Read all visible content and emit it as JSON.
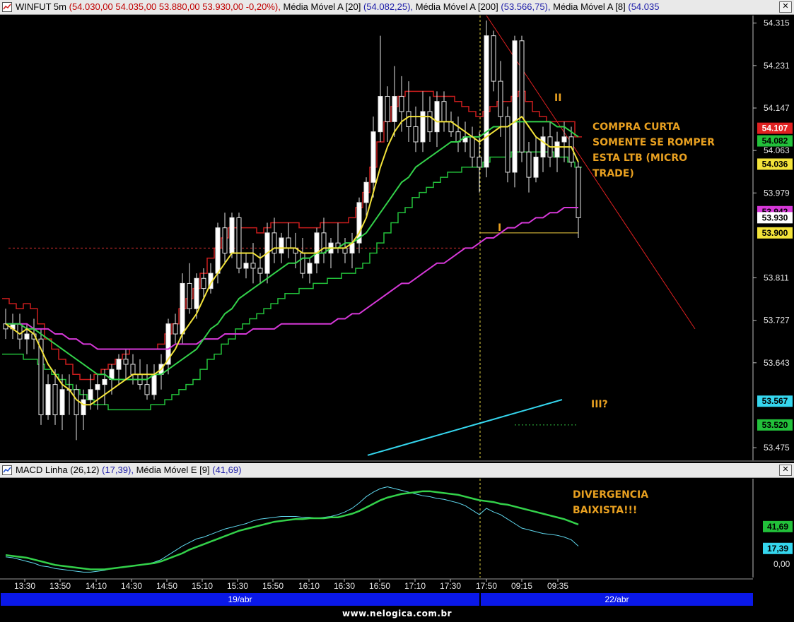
{
  "price_window": {
    "title_symbol": "WINFUT 5m",
    "title_ohlc": "(54.030,00  54.035,00  53.880,00  53.930,00  -0,20%),",
    "title_ma20_label": "Média Móvel A [20]",
    "title_ma20_value": "(54.082,25),",
    "title_ma200_label": "Média Móvel A [200]",
    "title_ma200_value": "(53.566,75),",
    "title_ma8_label": "Média Móvel A [8]",
    "title_ma8_value": "(54.035",
    "close_glyph": "✕"
  },
  "macd_window": {
    "title_label": "MACD Linha (26,12)",
    "title_value": "(17,39),",
    "title_signal_label": "Média Móvel E [9]",
    "title_signal_value": "(41,69)",
    "close_glyph": "✕"
  },
  "annotations": {
    "compra": [
      "COMPRA CURTA",
      "SOMENTE SE ROMPER",
      "ESTA LTB (MICRO",
      "TRADE)"
    ],
    "wave1": "I",
    "wave2": "II",
    "wave3": "III?",
    "divergencia": [
      "DIVERGENCIA",
      "BAIXISTA!!!"
    ]
  },
  "date_bands": {
    "left": "19/abr",
    "right": "22/abr"
  },
  "credit": "www.nelogica.com.br",
  "colors": {
    "ma8": "#f3e33a",
    "ma20": "#33d14a",
    "ma200_pink": "#d638d8",
    "ma_cyan": "#35d6ee",
    "stop_red": "#e02020",
    "stop_green": "#22c03a",
    "note": "#e8a020",
    "macd": "#5fd8ee",
    "signal": "#33d14a",
    "band": "#0a18e8"
  },
  "chart_data": [
    {
      "type": "candlestick",
      "title": "WINFUT 5m",
      "ylim": [
        53.45,
        54.33
      ],
      "y_ticks": [
        "54.315",
        "54.231",
        "54.147",
        "54.063",
        "53.979",
        "53.811",
        "53.727",
        "53.643",
        "53.475"
      ],
      "x_ticks": [
        "13:30",
        "13:50",
        "14:10",
        "14:30",
        "14:50",
        "15:10",
        "15:30",
        "15:50",
        "16:10",
        "16:30",
        "16:50",
        "17:10",
        "17:30",
        "17:50",
        "09:15",
        "09:35"
      ],
      "candles": [
        [
          53.72,
          53.75,
          53.69,
          53.71
        ],
        [
          53.71,
          53.74,
          53.69,
          53.72
        ],
        [
          53.72,
          53.74,
          53.67,
          53.69
        ],
        [
          53.69,
          53.72,
          53.66,
          53.7
        ],
        [
          53.7,
          53.73,
          53.67,
          53.69
        ],
        [
          53.69,
          53.71,
          53.52,
          53.54
        ],
        [
          53.54,
          53.62,
          53.53,
          53.6
        ],
        [
          53.6,
          53.63,
          53.52,
          53.54
        ],
        [
          53.54,
          53.62,
          53.51,
          53.59
        ],
        [
          53.59,
          53.62,
          53.54,
          53.59
        ],
        [
          53.59,
          53.6,
          53.49,
          53.54
        ],
        [
          53.54,
          53.59,
          53.51,
          53.57
        ],
        [
          53.57,
          53.62,
          53.55,
          53.59
        ],
        [
          53.59,
          53.62,
          53.55,
          53.6
        ],
        [
          53.6,
          53.63,
          53.56,
          53.61
        ],
        [
          53.61,
          53.64,
          53.58,
          53.63
        ],
        [
          53.63,
          53.66,
          53.6,
          53.65
        ],
        [
          53.65,
          53.67,
          53.61,
          53.64
        ],
        [
          53.64,
          53.66,
          53.6,
          53.62
        ],
        [
          53.62,
          53.65,
          53.59,
          53.6
        ],
        [
          53.6,
          53.64,
          53.57,
          53.58
        ],
        [
          53.58,
          53.64,
          53.57,
          53.62
        ],
        [
          53.62,
          53.66,
          53.59,
          53.64
        ],
        [
          53.64,
          53.73,
          53.62,
          53.72
        ],
        [
          53.72,
          53.74,
          53.68,
          53.7
        ],
        [
          53.7,
          53.82,
          53.68,
          53.8
        ],
        [
          53.8,
          53.84,
          53.74,
          53.75
        ],
        [
          53.75,
          53.82,
          53.73,
          53.81
        ],
        [
          53.81,
          53.83,
          53.77,
          53.79
        ],
        [
          53.79,
          53.84,
          53.78,
          53.82
        ],
        [
          53.82,
          53.92,
          53.8,
          53.91
        ],
        [
          53.91,
          53.94,
          53.84,
          53.86
        ],
        [
          53.86,
          53.94,
          53.85,
          53.93
        ],
        [
          53.93,
          53.94,
          53.82,
          53.83
        ],
        [
          53.83,
          53.86,
          53.81,
          53.84
        ],
        [
          53.84,
          53.88,
          53.8,
          53.83
        ],
        [
          53.83,
          53.86,
          53.8,
          53.82
        ],
        [
          53.82,
          53.92,
          53.8,
          53.9
        ],
        [
          53.9,
          53.93,
          53.84,
          53.86
        ],
        [
          53.86,
          53.9,
          53.84,
          53.89
        ],
        [
          53.89,
          53.92,
          53.85,
          53.87
        ],
        [
          53.87,
          53.9,
          53.83,
          53.86
        ],
        [
          53.86,
          53.89,
          53.81,
          53.82
        ],
        [
          53.82,
          53.85,
          53.8,
          53.84
        ],
        [
          53.84,
          53.91,
          53.82,
          53.9
        ],
        [
          53.9,
          53.93,
          53.84,
          53.86
        ],
        [
          53.86,
          53.89,
          53.83,
          53.88
        ],
        [
          53.88,
          53.92,
          53.86,
          53.87
        ],
        [
          53.87,
          53.89,
          53.84,
          53.86
        ],
        [
          53.86,
          53.9,
          53.83,
          53.88
        ],
        [
          53.88,
          53.97,
          53.86,
          53.96
        ],
        [
          53.96,
          54.01,
          53.93,
          54.0
        ],
        [
          54.0,
          54.13,
          53.97,
          54.1
        ],
        [
          54.1,
          54.29,
          54.08,
          54.17
        ],
        [
          54.17,
          54.19,
          54.08,
          54.12
        ],
        [
          54.12,
          54.23,
          54.09,
          54.17
        ],
        [
          54.17,
          54.21,
          54.1,
          54.14
        ],
        [
          54.14,
          54.2,
          54.08,
          54.11
        ],
        [
          54.11,
          54.15,
          54.06,
          54.08
        ],
        [
          54.08,
          54.18,
          54.06,
          54.14
        ],
        [
          54.14,
          54.17,
          54.08,
          54.1
        ],
        [
          54.1,
          54.18,
          54.07,
          54.16
        ],
        [
          54.16,
          54.18,
          54.1,
          54.12
        ],
        [
          54.12,
          54.14,
          54.09,
          54.1
        ],
        [
          54.1,
          54.13,
          54.06,
          54.08
        ],
        [
          54.08,
          54.12,
          54.06,
          54.09
        ],
        [
          54.09,
          54.11,
          54.03,
          54.05
        ],
        [
          54.05,
          54.1,
          53.98,
          54.03
        ],
        [
          54.03,
          54.32,
          54.01,
          54.29
        ],
        [
          54.29,
          54.3,
          54.18,
          54.2
        ],
        [
          54.2,
          54.24,
          54.09,
          54.13
        ],
        [
          54.13,
          54.15,
          54.0,
          54.02
        ],
        [
          54.02,
          54.29,
          53.99,
          54.28
        ],
        [
          54.28,
          54.29,
          54.04,
          54.06
        ],
        [
          54.06,
          54.08,
          53.98,
          54.01
        ],
        [
          54.01,
          54.09,
          54.0,
          54.05
        ],
        [
          54.05,
          54.11,
          54.02,
          54.09
        ],
        [
          54.09,
          54.12,
          54.03,
          54.05
        ],
        [
          54.05,
          54.1,
          54.02,
          54.08
        ],
        [
          54.08,
          54.12,
          54.04,
          54.09
        ],
        [
          54.09,
          54.11,
          54.03,
          54.04
        ],
        [
          54.03,
          54.04,
          53.89,
          53.93
        ]
      ],
      "overlays": {
        "ma8": [
          53.72,
          53.71,
          53.7,
          53.71,
          53.7,
          53.67,
          53.64,
          53.62,
          53.6,
          53.59,
          53.57,
          53.56,
          53.56,
          53.57,
          53.58,
          53.59,
          53.6,
          53.61,
          53.62,
          53.62,
          53.62,
          53.62,
          53.63,
          53.65,
          53.67,
          53.7,
          53.72,
          53.74,
          53.77,
          53.8,
          53.82,
          53.84,
          53.86,
          53.86,
          53.86,
          53.86,
          53.85,
          53.86,
          53.87,
          53.87,
          53.87,
          53.87,
          53.86,
          53.86,
          53.86,
          53.87,
          53.87,
          53.87,
          53.87,
          53.88,
          53.9,
          53.93,
          53.98,
          54.03,
          54.07,
          54.1,
          54.12,
          54.13,
          54.13,
          54.13,
          54.13,
          54.12,
          54.12,
          54.12,
          54.11,
          54.1,
          54.09,
          54.08,
          54.09,
          54.1,
          54.11,
          54.11,
          54.12,
          54.13,
          54.11,
          54.09,
          54.08,
          54.07,
          54.07,
          54.07,
          54.07,
          54.04
        ],
        "ma20": [
          53.72,
          53.72,
          53.72,
          53.71,
          53.71,
          53.7,
          53.69,
          53.68,
          53.67,
          53.66,
          53.65,
          53.64,
          53.63,
          53.62,
          53.62,
          53.61,
          53.61,
          53.61,
          53.61,
          53.61,
          53.61,
          53.62,
          53.62,
          53.63,
          53.64,
          53.65,
          53.66,
          53.67,
          53.69,
          53.71,
          53.72,
          53.74,
          53.75,
          53.77,
          53.78,
          53.79,
          53.8,
          53.81,
          53.82,
          53.83,
          53.84,
          53.84,
          53.85,
          53.85,
          53.86,
          53.86,
          53.87,
          53.87,
          53.88,
          53.88,
          53.89,
          53.9,
          53.92,
          53.94,
          53.96,
          53.98,
          54.0,
          54.01,
          54.03,
          54.04,
          54.05,
          54.06,
          54.07,
          54.08,
          54.08,
          54.09,
          54.09,
          54.09,
          54.1,
          54.11,
          54.11,
          54.11,
          54.12,
          54.12,
          54.12,
          54.12,
          54.12,
          54.12,
          54.11,
          54.11,
          54.1,
          54.09
        ],
        "ma_pink": [
          53.72,
          53.72,
          53.72,
          53.72,
          53.71,
          53.71,
          53.71,
          53.7,
          53.7,
          53.69,
          53.69,
          53.68,
          53.68,
          53.67,
          53.67,
          53.67,
          53.67,
          53.67,
          53.67,
          53.67,
          53.67,
          53.67,
          53.67,
          53.67,
          53.68,
          53.68,
          53.68,
          53.68,
          53.69,
          53.69,
          53.69,
          53.7,
          53.7,
          53.7,
          53.7,
          53.71,
          53.71,
          53.71,
          53.71,
          53.72,
          53.72,
          53.72,
          53.72,
          53.72,
          53.72,
          53.72,
          53.72,
          53.73,
          53.73,
          53.74,
          53.74,
          53.75,
          53.76,
          53.77,
          53.78,
          53.79,
          53.8,
          53.8,
          53.81,
          53.82,
          53.83,
          53.84,
          53.84,
          53.85,
          53.86,
          53.87,
          53.87,
          53.88,
          53.89,
          53.89,
          53.9,
          53.91,
          53.91,
          53.92,
          53.92,
          53.93,
          53.93,
          53.94,
          53.94,
          53.95,
          53.95,
          53.95
        ],
        "ma_cyan": [
          53.46,
          53.47,
          53.48,
          53.49,
          53.5,
          53.51,
          53.52,
          53.53,
          53.54,
          53.55,
          53.56,
          53.57
        ]
      },
      "horizontal_levels": [
        {
          "name": "I",
          "value": 53.9
        },
        {
          "name": "red-dotted",
          "value": 53.87
        },
        {
          "name": "green-dotted",
          "value": 53.52
        }
      ],
      "trendline": {
        "from": [
          68,
          54.33
        ],
        "to": [
          89,
          53.71
        ]
      },
      "price_labels": [
        {
          "text": "54.107",
          "value": 54.107,
          "bg": "#e02020",
          "fg": "#ffffff"
        },
        {
          "text": "54.082",
          "value": 54.082,
          "bg": "#22c03a",
          "fg": "#000000"
        },
        {
          "text": "54.036",
          "value": 54.036,
          "bg": "#f3e33a",
          "fg": "#000000"
        },
        {
          "text": "53.942",
          "value": 53.942,
          "bg": "#d638d8",
          "fg": "#000000"
        },
        {
          "text": "53.930",
          "value": 53.93,
          "bg": "#ffffff",
          "fg": "#000000"
        },
        {
          "text": "53.900",
          "value": 53.9,
          "bg": "#f3e33a",
          "fg": "#000000"
        },
        {
          "text": "53.567",
          "value": 53.567,
          "bg": "#35d6ee",
          "fg": "#000000"
        },
        {
          "text": "53.520",
          "value": 53.52,
          "bg": "#22c03a",
          "fg": "#000000"
        }
      ]
    },
    {
      "type": "line",
      "title": "MACD Linha (26,12)",
      "ylim": [
        -15,
        95
      ],
      "y_ticks": [
        "0,00"
      ],
      "series": [
        {
          "name": "MACD Linha (26,12)",
          "values": [
            8,
            7,
            5,
            3,
            1,
            -2,
            -3,
            -5,
            -6,
            -7,
            -8,
            -9,
            -9,
            -8,
            -7,
            -5,
            -4,
            -3,
            -2,
            -1,
            0,
            2,
            5,
            10,
            15,
            20,
            24,
            28,
            30,
            33,
            36,
            39,
            41,
            43,
            45,
            48,
            50,
            51,
            52,
            53,
            53,
            53,
            52,
            52,
            51,
            52,
            53,
            55,
            58,
            62,
            68,
            75,
            80,
            84,
            86,
            84,
            82,
            80,
            78,
            76,
            75,
            73,
            72,
            70,
            68,
            65,
            60,
            55,
            62,
            58,
            55,
            50,
            45,
            40,
            38,
            36,
            34,
            33,
            32,
            30,
            27,
            20
          ]
        },
        {
          "name": "Média Móvel E [9]",
          "values": [
            10,
            9,
            8,
            7,
            5,
            3,
            1,
            -1,
            -2,
            -3,
            -4,
            -5,
            -6,
            -6,
            -6,
            -5,
            -4,
            -3,
            -2,
            -1,
            0,
            1,
            3,
            6,
            9,
            12,
            16,
            19,
            22,
            25,
            28,
            31,
            34,
            37,
            39,
            41,
            43,
            45,
            47,
            48,
            49,
            50,
            50,
            51,
            51,
            51,
            52,
            52,
            54,
            56,
            59,
            63,
            67,
            71,
            74,
            76,
            78,
            79,
            80,
            81,
            81,
            80,
            79,
            78,
            77,
            75,
            73,
            71,
            70,
            69,
            67,
            66,
            64,
            62,
            60,
            58,
            56,
            54,
            52,
            50,
            47,
            44
          ]
        }
      ],
      "price_labels": [
        {
          "text": "41,69",
          "value": 41.69,
          "bg": "#22c03a",
          "fg": "#000000"
        },
        {
          "text": "17,39",
          "value": 17.39,
          "bg": "#35d6ee",
          "fg": "#000000"
        }
      ]
    }
  ]
}
